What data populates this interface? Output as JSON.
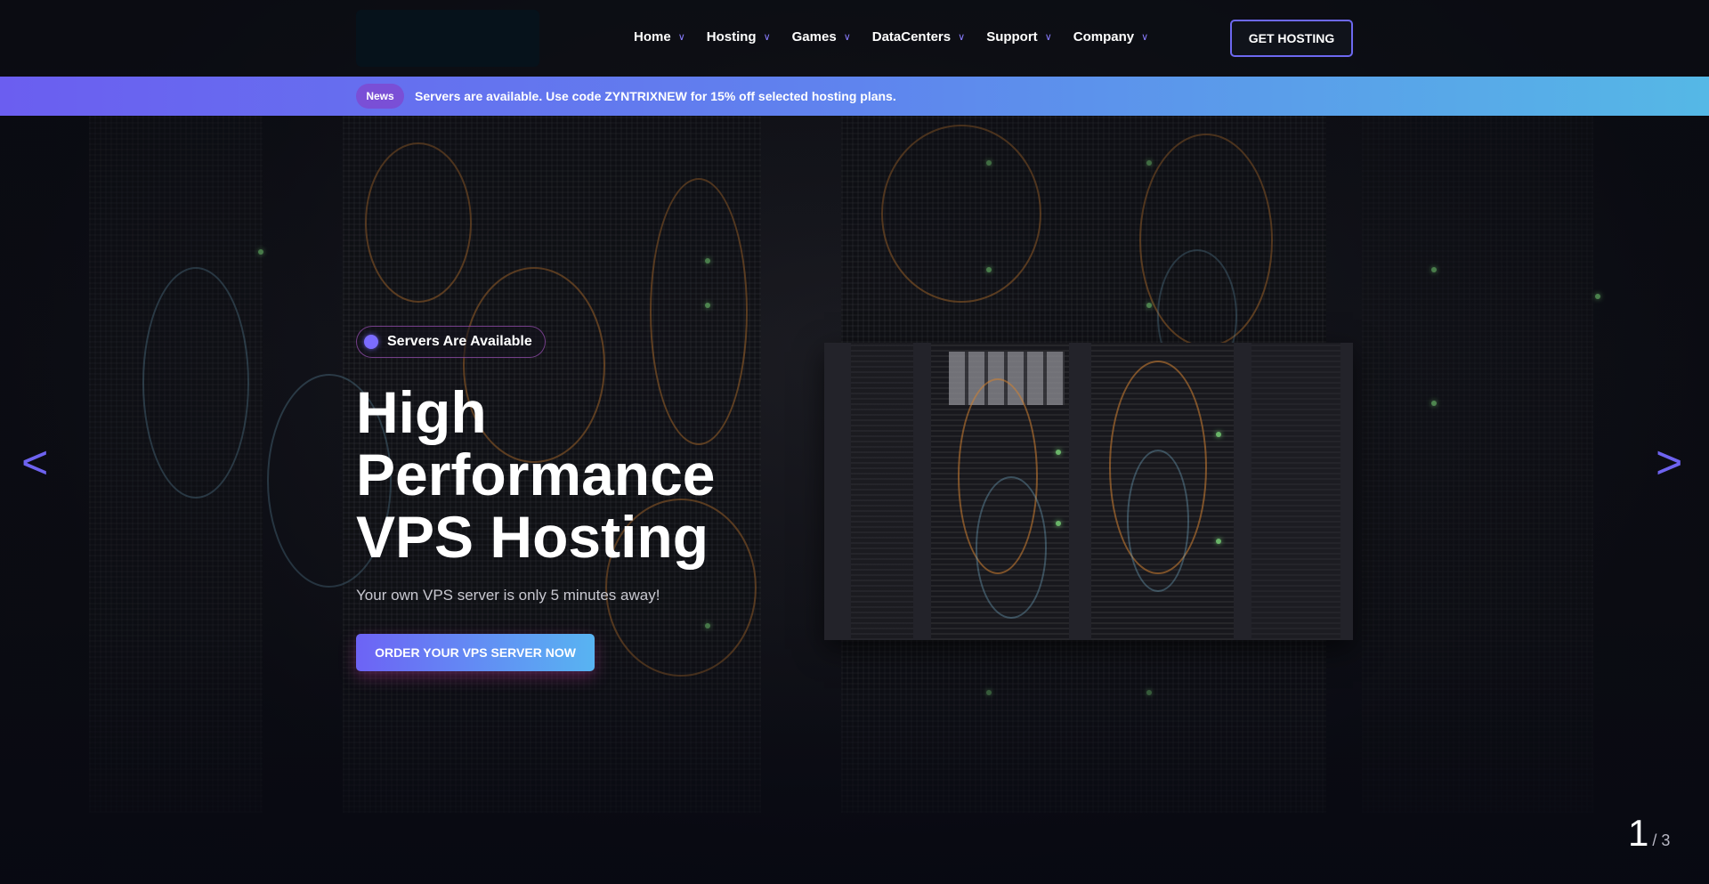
{
  "header": {
    "nav": [
      {
        "label": "Home",
        "chevron": "∨"
      },
      {
        "label": "Hosting",
        "chevron": "∨"
      },
      {
        "label": "Games",
        "chevron": "∨"
      },
      {
        "label": "DataCenters",
        "chevron": "∨"
      },
      {
        "label": "Support",
        "chevron": "∨"
      },
      {
        "label": "Company",
        "chevron": "∨"
      }
    ],
    "cta_label": "GET HOSTING"
  },
  "news": {
    "badge": "News",
    "text": "Servers are available. Use code ZYNTRIXNEW for 15% off selected hosting plans."
  },
  "hero": {
    "status": "Servers Are Available",
    "title_line1": "High",
    "title_line2": "Performance",
    "title_line3": "VPS Hosting",
    "subtitle": "Your own VPS server is only 5 minutes away!",
    "button_label": "ORDER YOUR VPS SERVER NOW"
  },
  "slider": {
    "prev_label": "<",
    "next_label": ">",
    "current": "1",
    "total": "/ 3"
  },
  "colors": {
    "accent": "#6e63f0",
    "news_gradient_start": "#6b5ef0",
    "news_gradient_end": "#55b8e6"
  }
}
